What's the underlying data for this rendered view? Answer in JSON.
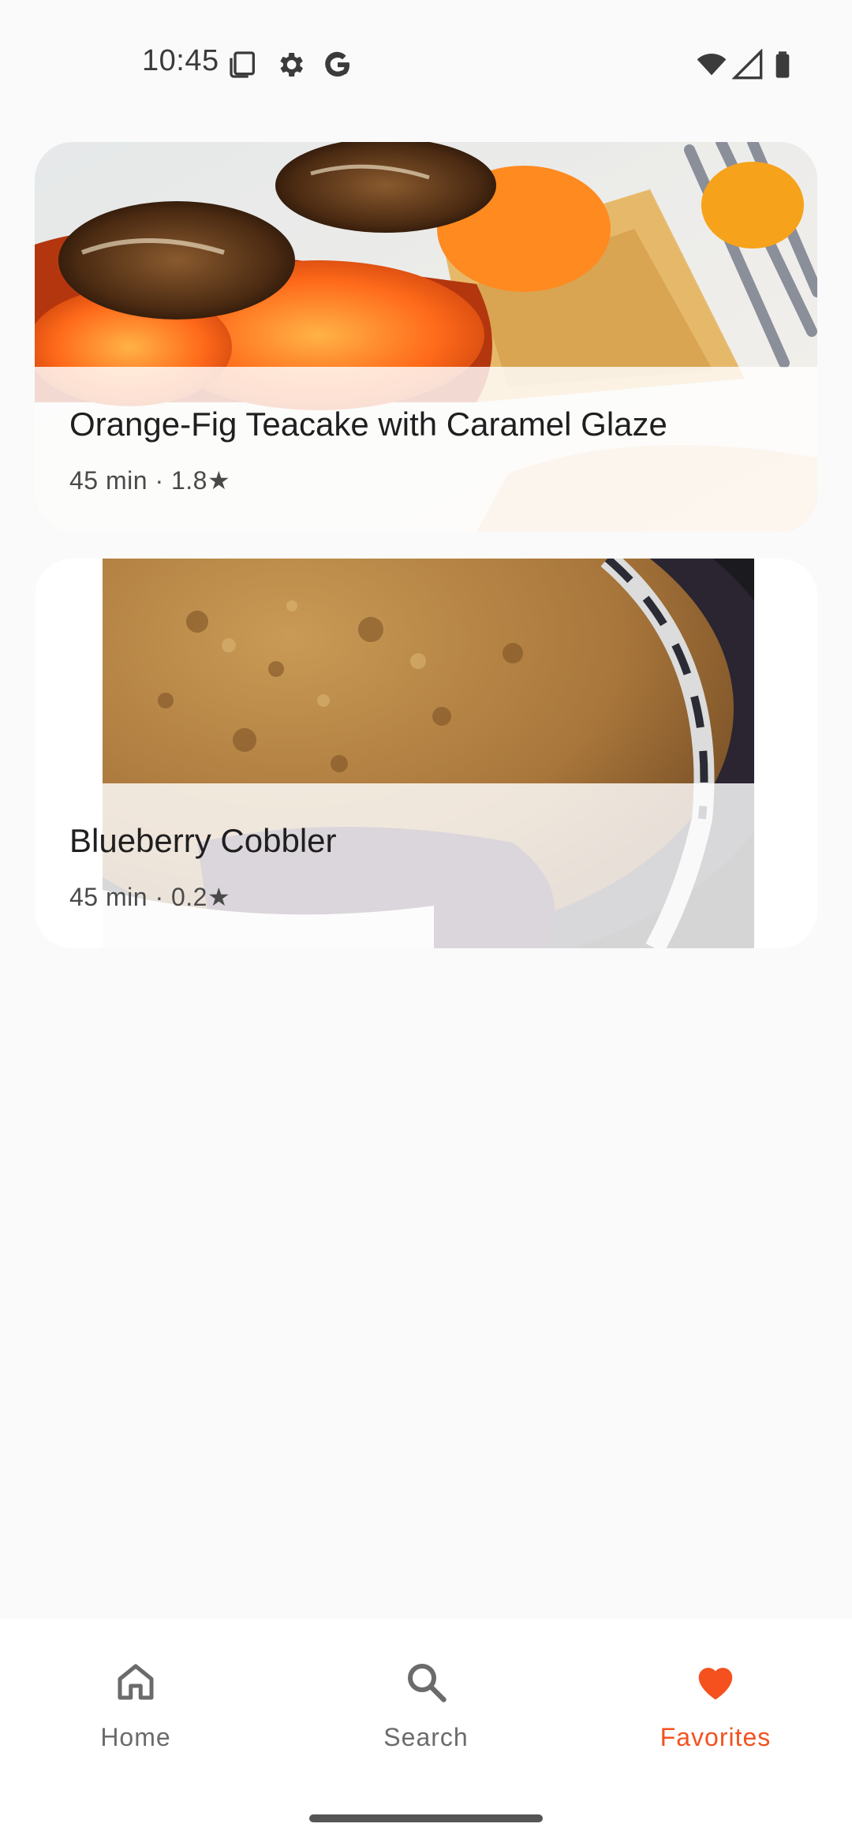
{
  "status_bar": {
    "time": "10:45",
    "icons": [
      "screenshot-icon",
      "gear-icon",
      "google-icon",
      "wifi-icon",
      "signal-icon",
      "battery-icon"
    ]
  },
  "recipes": [
    {
      "title": "Orange-Fig Teacake with Caramel Glaze",
      "meta": "45 min · 1.8★",
      "image": "orange-fig-teacake-photo"
    },
    {
      "title": "Blueberry Cobbler",
      "meta": "45 min · 0.2★",
      "image": "blueberry-cobbler-photo"
    }
  ],
  "bottom_nav": {
    "items": [
      {
        "label": "Home",
        "icon": "home-icon",
        "active": false
      },
      {
        "label": "Search",
        "icon": "search-icon",
        "active": false
      },
      {
        "label": "Favorites",
        "icon": "heart-icon",
        "active": true
      }
    ]
  },
  "colors": {
    "accent": "#f4511e",
    "inactive": "#6b6b6b",
    "background": "#fafafa"
  }
}
